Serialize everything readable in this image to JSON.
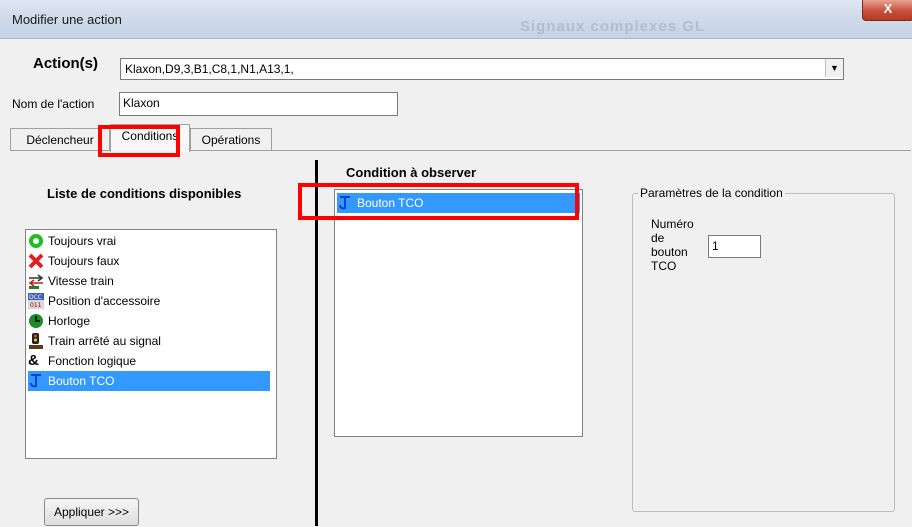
{
  "window": {
    "title": "Modifier une action",
    "background_title": "Signaux complexes GL",
    "close_label": "X"
  },
  "action": {
    "label": "Action(s)",
    "value": "Klaxon,D9,3,B1,C8,1,N1,A13,1,",
    "dropdown_icon": "triangle-down"
  },
  "name": {
    "label": "Nom de l'action",
    "value": "Klaxon"
  },
  "tabs": [
    {
      "label": "Déclencheur",
      "active": false
    },
    {
      "label": "Conditions",
      "active": true
    },
    {
      "label": "Opérations",
      "active": false
    }
  ],
  "left": {
    "heading": "Liste de conditions disponibles",
    "items": [
      {
        "label": "Toujours vrai",
        "icon": "green-circle-icon"
      },
      {
        "label": "Toujours faux",
        "icon": "red-x-icon"
      },
      {
        "label": "Vitesse train",
        "icon": "speed-arrows-icon"
      },
      {
        "label": "Position d'accessoire",
        "icon": "dcc-accessory-icon",
        "icon_text": "DCC 011"
      },
      {
        "label": "Horloge",
        "icon": "clock-icon"
      },
      {
        "label": "Train arrêté au signal",
        "icon": "signal-icon"
      },
      {
        "label": "Fonction logique",
        "icon": "ampersand-icon",
        "icon_text": "&"
      },
      {
        "label": "Bouton TCO",
        "icon": "tco-button-icon",
        "selected": true
      }
    ],
    "apply_button": "Appliquer >>>"
  },
  "middle": {
    "heading": "Condition à observer",
    "items": [
      {
        "label": "Bouton TCO",
        "icon": "tco-button-icon",
        "selected": true
      }
    ]
  },
  "right": {
    "group_label": "Paramètres de la condition",
    "field_label_lines": [
      "Numéro",
      "de",
      "bouton",
      "TCO"
    ],
    "field_value": "1"
  },
  "colors": {
    "highlight": "#ff0000",
    "selection": "#3399ff"
  }
}
